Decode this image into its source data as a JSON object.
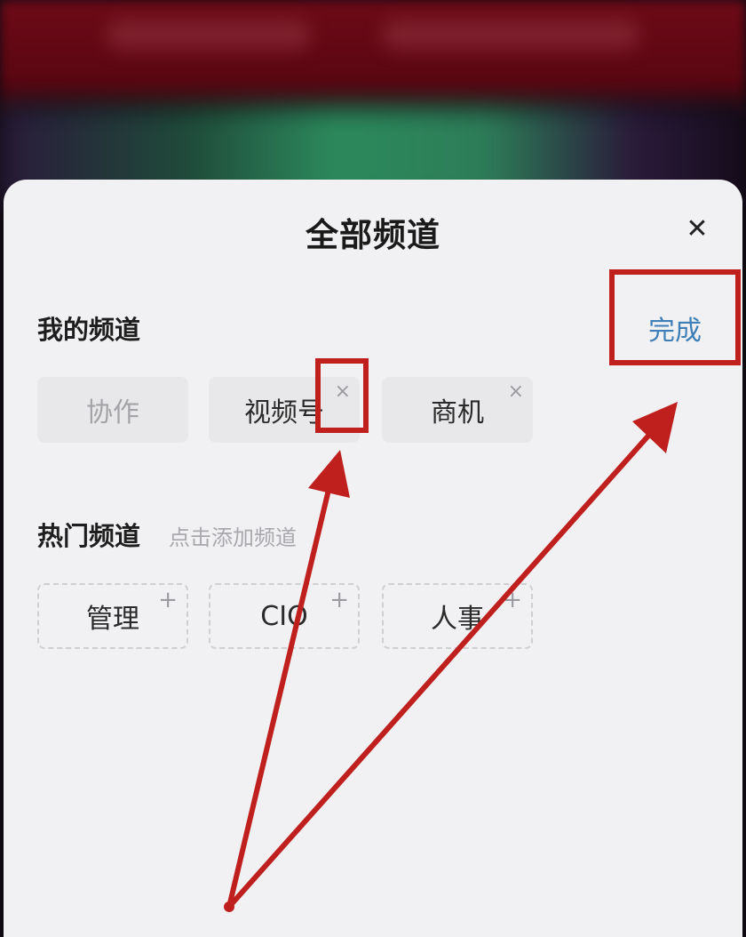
{
  "sheet": {
    "title": "全部频道",
    "close_icon": "close-icon"
  },
  "my_channels": {
    "label": "我的频道",
    "done_label": "完成",
    "items": [
      {
        "label": "协作",
        "removable": false
      },
      {
        "label": "视频号",
        "removable": true,
        "remove_glyph": "×"
      },
      {
        "label": "商机",
        "removable": true,
        "remove_glyph": "×"
      }
    ]
  },
  "hot_channels": {
    "label": "热门频道",
    "hint": "点击添加频道",
    "items": [
      {
        "label": "管理",
        "add_glyph": "+"
      },
      {
        "label": "CIO",
        "add_glyph": "+"
      },
      {
        "label": "人事",
        "add_glyph": "+"
      }
    ]
  },
  "colors": {
    "annotation_red": "#c0201d",
    "done_blue": "#3f7fb8",
    "sheet_bg": "#f1f1f3"
  }
}
